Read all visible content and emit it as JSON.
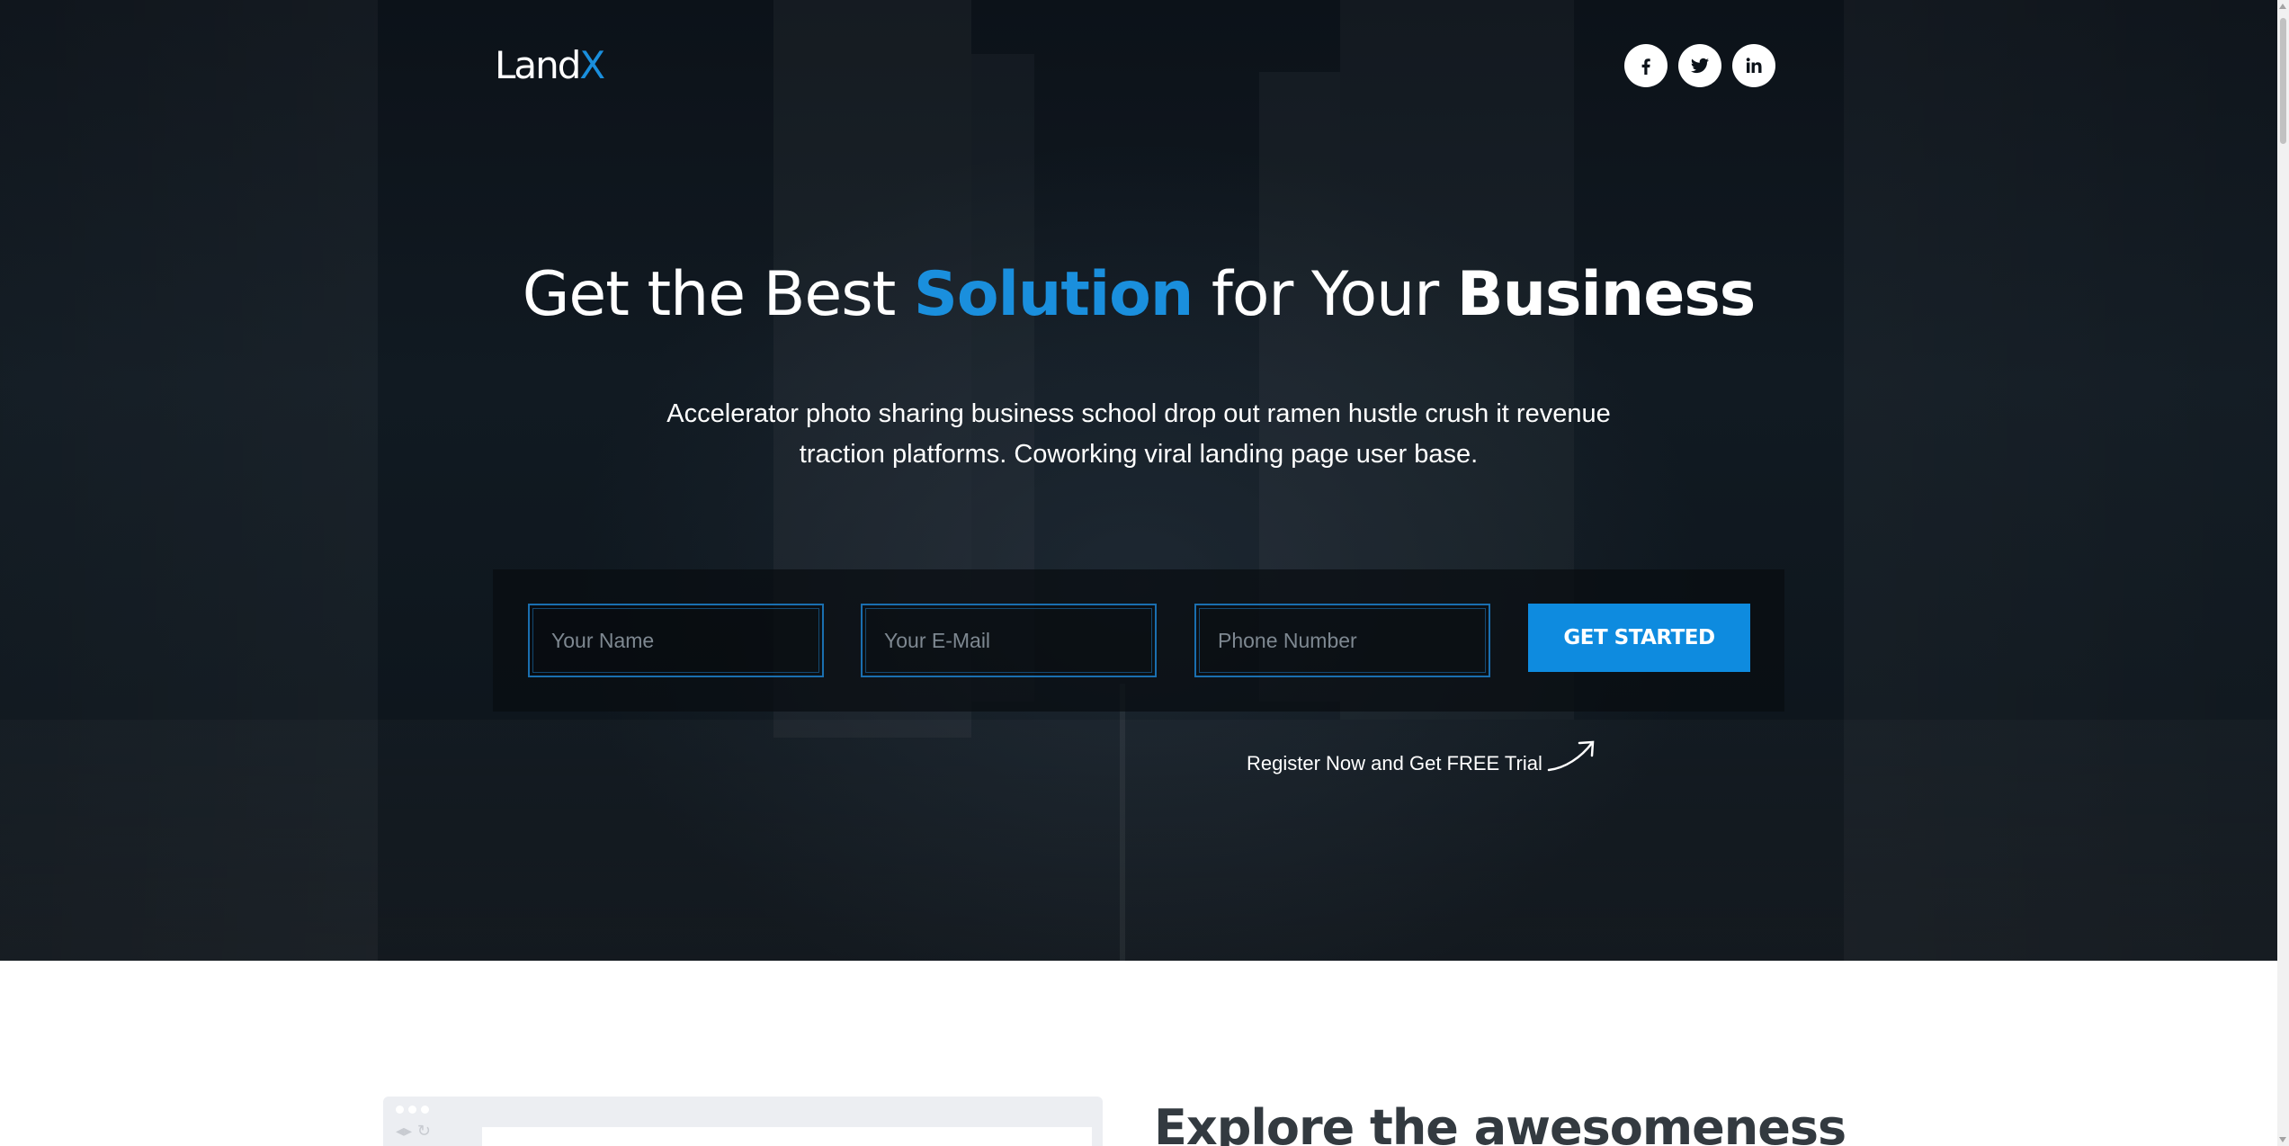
{
  "header": {
    "logo": {
      "part1": "Land",
      "part2": "X"
    },
    "social": [
      {
        "icon": "facebook-icon",
        "label": "f"
      },
      {
        "icon": "twitter-icon",
        "label": ""
      },
      {
        "icon": "linkedin-icon",
        "label": "in"
      }
    ]
  },
  "hero": {
    "headline": {
      "part1": "Get the Best ",
      "accent": "Solution",
      "part2": " for Your ",
      "strong": "Business"
    },
    "subtext": "Accelerator photo sharing business school drop out ramen hustle crush it revenue traction platforms. Coworking viral landing page user base.",
    "form": {
      "name_placeholder": "Your Name",
      "email_placeholder": "Your E-Mail",
      "phone_placeholder": "Phone Number",
      "submit_label": "GET STARTED"
    },
    "register_text": "Register Now and Get FREE Trial"
  },
  "features": {
    "title": "Explore the awesomeness"
  },
  "colors": {
    "accent": "#1a8fdd",
    "button": "#0e8bdf",
    "hero_bg": "#0e161d"
  }
}
